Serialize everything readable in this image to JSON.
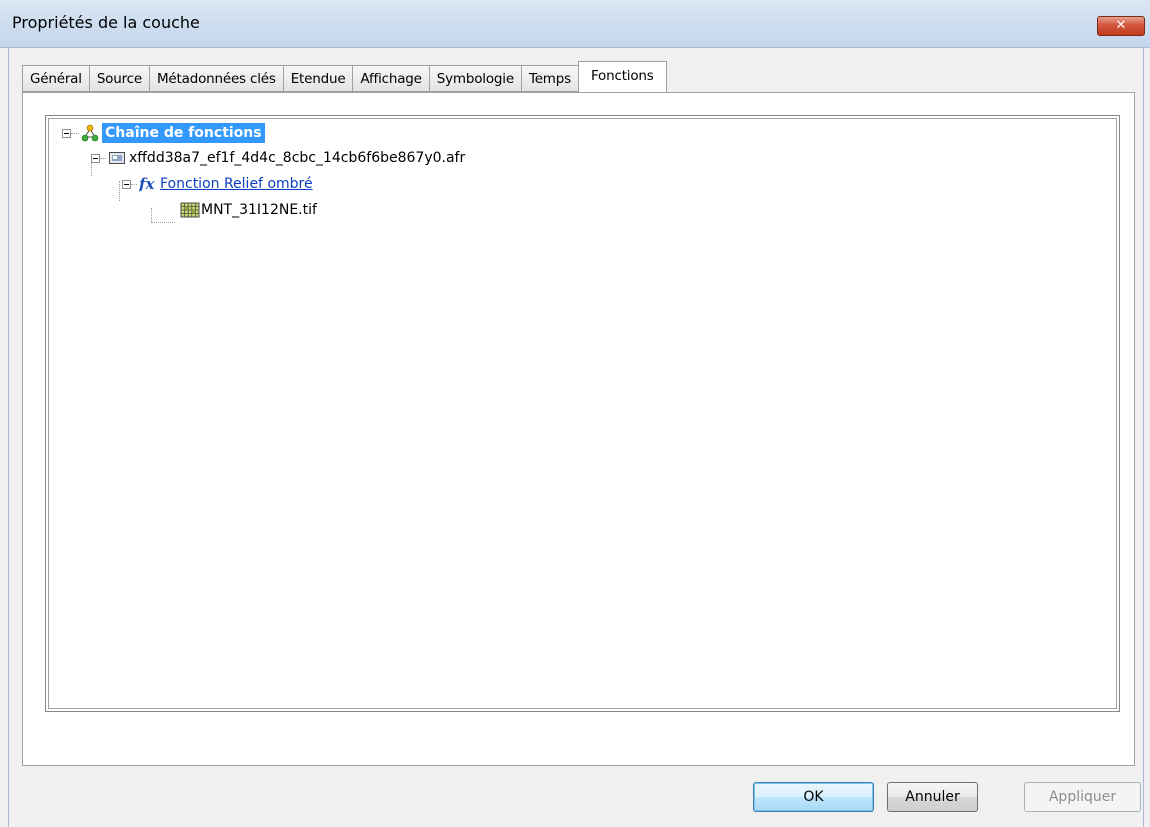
{
  "window": {
    "title": "Propriétés de la couche",
    "close_label": "✕"
  },
  "tabs": [
    {
      "label": "Général"
    },
    {
      "label": "Source"
    },
    {
      "label": "Métadonnées clés"
    },
    {
      "label": "Etendue"
    },
    {
      "label": "Affichage"
    },
    {
      "label": "Symbologie"
    },
    {
      "label": "Temps"
    },
    {
      "label": "Fonctions",
      "active": true
    }
  ],
  "tree": {
    "root": {
      "label": "Chaîne de fonctions",
      "icon": "function-chain-icon"
    },
    "dataset": {
      "label": "xffdd38a7_ef1f_4d4c_8cbc_14cb6f6be867y0.afr",
      "icon": "raster-dataset-icon"
    },
    "function": {
      "label": "Fonction Relief ombré",
      "icon": "fx-icon"
    },
    "raster": {
      "label": "MNT_31I12NE.tif",
      "icon": "raster-grid-icon"
    }
  },
  "buttons": {
    "ok": "OK",
    "cancel": "Annuler",
    "apply": "Appliquer"
  }
}
